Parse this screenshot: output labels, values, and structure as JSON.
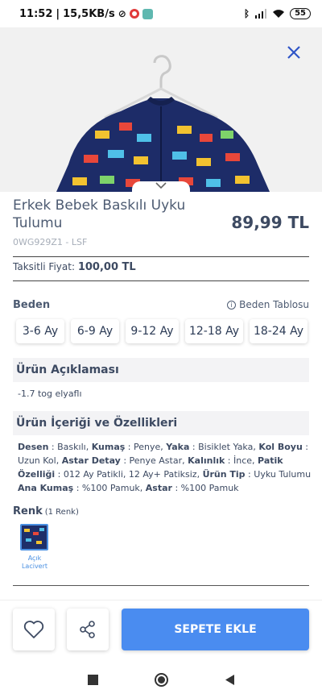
{
  "status_bar": {
    "time": "11:52",
    "network_speed": "15,5KB/s",
    "battery": "55"
  },
  "product": {
    "title": "Erkek Bebek Baskılı Uyku Tulumu",
    "price": "89,99 TL",
    "code": "0WG929Z1 - LSF",
    "installment_label": "Taksitli Fiyat:",
    "installment_price": "100,00 TL"
  },
  "sizes": {
    "label": "Beden",
    "table_link": "Beden Tablosu",
    "options": [
      "3-6 Ay",
      "6-9 Ay",
      "9-12 Ay",
      "12-18 Ay",
      "18-24 Ay"
    ]
  },
  "description": {
    "heading": "Ürün Açıklaması",
    "text": "-1.7 tog elyaflı"
  },
  "features": {
    "heading": "Ürün İçeriği ve Özellikleri",
    "items": [
      {
        "k": "Desen",
        "v": "Baskılı"
      },
      {
        "k": "Kumaş",
        "v": "Penye"
      },
      {
        "k": "Yaka",
        "v": "Bisiklet Yaka"
      },
      {
        "k": "Kol Boyu",
        "v": "Uzun Kol"
      },
      {
        "k": "Astar Detay",
        "v": "Penye Astar"
      },
      {
        "k": "Kalınlık",
        "v": "İnce"
      },
      {
        "k": "Patik Özelliği",
        "v": "012 Ay Patikli, 12 Ay+ Patiksiz"
      },
      {
        "k": "Ürün Tip",
        "v": "Uyku Tulumu"
      },
      {
        "k": "Ana Kumaş",
        "v": "%100 Pamuk"
      },
      {
        "k": "Astar",
        "v": "%100 Pamuk"
      }
    ]
  },
  "color": {
    "label": "Renk",
    "count": "(1 Renk)",
    "swatch_name": "Açık Lacivert",
    "swatch_color": "#1e2f6a"
  },
  "actions": {
    "add_to_cart": "SEPETE EKLE"
  },
  "colors": {
    "accent": "#4a8cf0",
    "text": "#3d4a62"
  },
  "icons": [
    "close-icon",
    "chevron-down-icon",
    "info-icon",
    "heart-icon",
    "share-icon",
    "nav-square-icon",
    "nav-circle-icon",
    "nav-back-icon"
  ]
}
